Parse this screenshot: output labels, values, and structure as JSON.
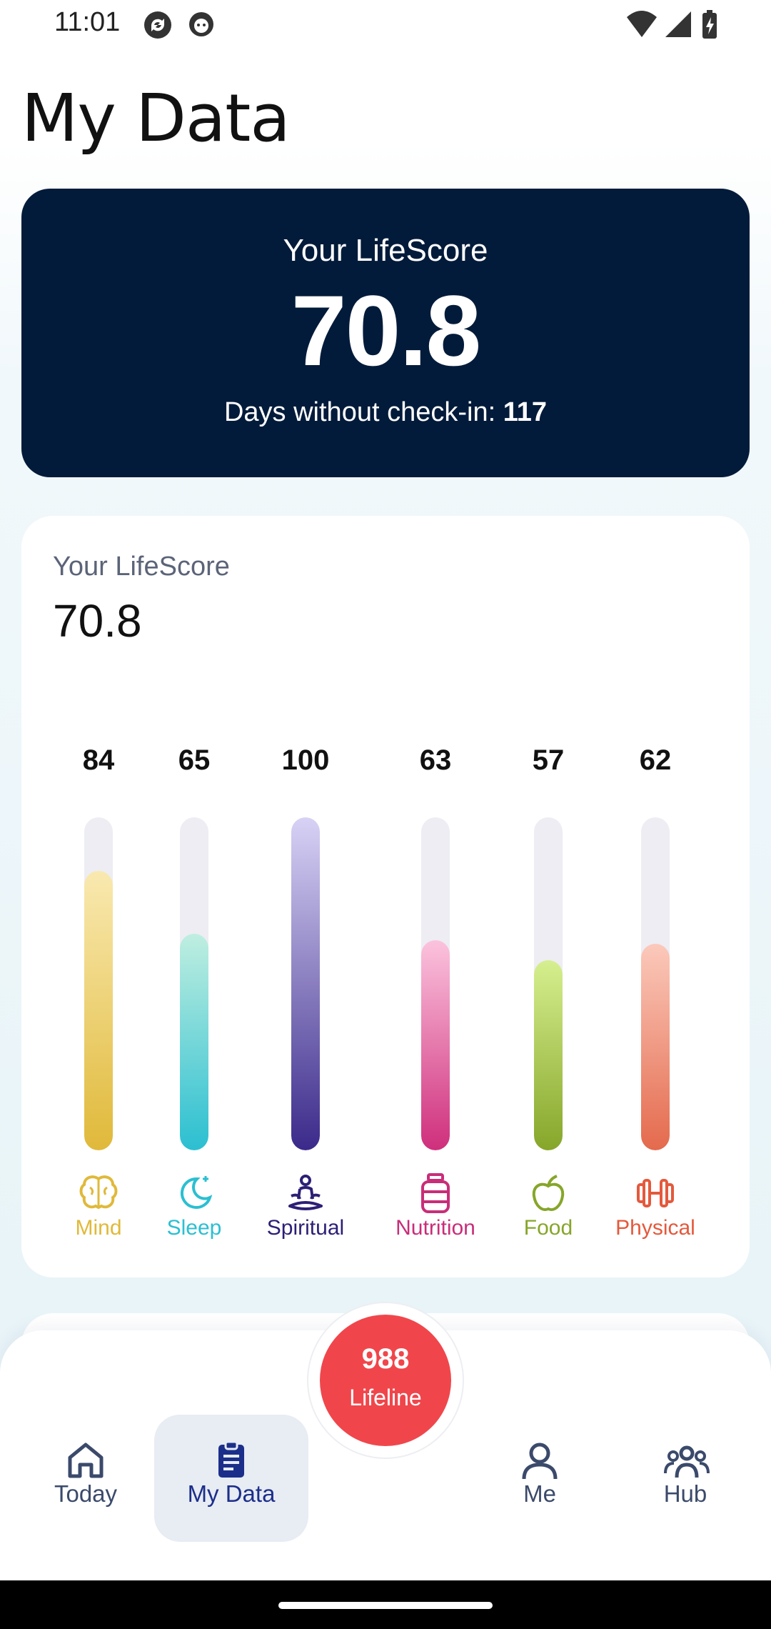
{
  "status_bar": {
    "time": "11:01",
    "icons": [
      "sync-icon",
      "android-icon",
      "wifi-icon",
      "signal-icon",
      "battery-charging-icon"
    ]
  },
  "page": {
    "title": "My Data"
  },
  "banner": {
    "label": "Your LifeScore",
    "score": "70.8",
    "days_label": "Days without check-in:",
    "days_value": "117"
  },
  "chart_card": {
    "label": "Your LifeScore",
    "score": "70.8"
  },
  "chart_data": {
    "type": "bar",
    "categories": [
      "Mind",
      "Sleep",
      "Spiritual",
      "Nutrition",
      "Food",
      "Physical"
    ],
    "values": [
      84,
      65,
      100,
      63,
      57,
      62
    ],
    "ylim": [
      0,
      100
    ],
    "title": "Your LifeScore",
    "xlabel": "",
    "ylabel": "",
    "grid": false,
    "colors": [
      {
        "name": "Mind",
        "top": "#f9e9b0",
        "bottom": "#e0b93a",
        "label": "#e0b93a",
        "icon": "brain-icon"
      },
      {
        "name": "Sleep",
        "top": "#bfeee0",
        "bottom": "#2bbfd1",
        "label": "#2bbfd1",
        "icon": "moon-stars-icon"
      },
      {
        "name": "Spiritual",
        "top": "#d8d2f5",
        "bottom": "#3b2a8a",
        "label": "#2c1f76",
        "icon": "meditation-icon"
      },
      {
        "name": "Nutrition",
        "top": "#fbc3dd",
        "bottom": "#cf2f7c",
        "label": "#c92d78",
        "icon": "supplement-jar-icon"
      },
      {
        "name": "Food",
        "top": "#d6ef8f",
        "bottom": "#86a62a",
        "label": "#86a62a",
        "icon": "apple-icon"
      },
      {
        "name": "Physical",
        "top": "#fbc9bb",
        "bottom": "#e46a4d",
        "label": "#e4593c",
        "icon": "dumbbell-icon"
      }
    ]
  },
  "lifeline": {
    "count": "988",
    "label": "Lifeline"
  },
  "nav": {
    "items": [
      {
        "label": "Today",
        "icon": "home-icon"
      },
      {
        "label": "My Data",
        "icon": "clipboard-icon",
        "active": true
      },
      {
        "label": "Me",
        "icon": "person-icon"
      },
      {
        "label": "Hub",
        "icon": "group-icon"
      }
    ]
  }
}
